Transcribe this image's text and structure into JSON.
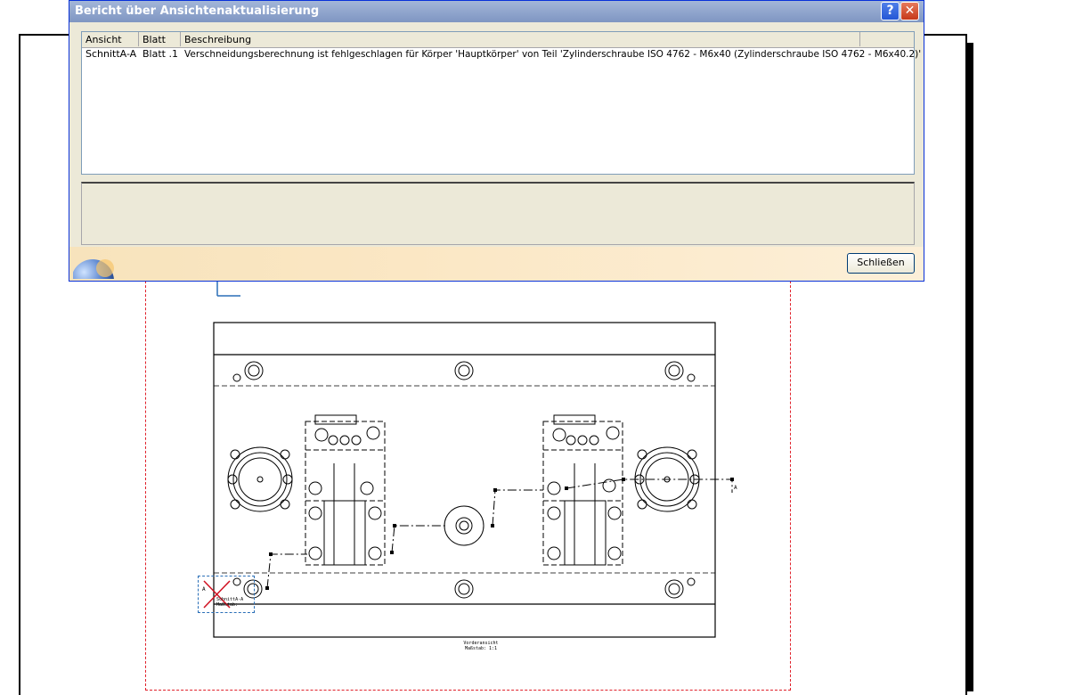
{
  "dialog": {
    "title": "Bericht über Ansichtenaktualisierung",
    "help_label": "?",
    "close_label": "✕",
    "columns": [
      "Ansicht",
      "Blatt",
      "Beschreibung"
    ],
    "rows": [
      {
        "ansicht": "SchnittA-A",
        "blatt": "Blatt .1",
        "beschreibung": "Verschneidungsberechnung ist fehlgeschlagen für Körper 'Hauptkörper' von Teil 'Zylinderschraube ISO 4762 - M6x40 (Zylinderschraube ISO 4762 - M6x40.2)'"
      }
    ],
    "close_button_label": "Schließen"
  },
  "drawing": {
    "view_caption_line1": "Vorderansicht",
    "view_caption_line2": "Maßstab:   1:1",
    "section_label_line1": "SchnittA-A",
    "section_label_line2": "Maßstab:",
    "section_marker": "A",
    "view_color": "#e0202a",
    "callout_color": "#2a6fb7"
  }
}
